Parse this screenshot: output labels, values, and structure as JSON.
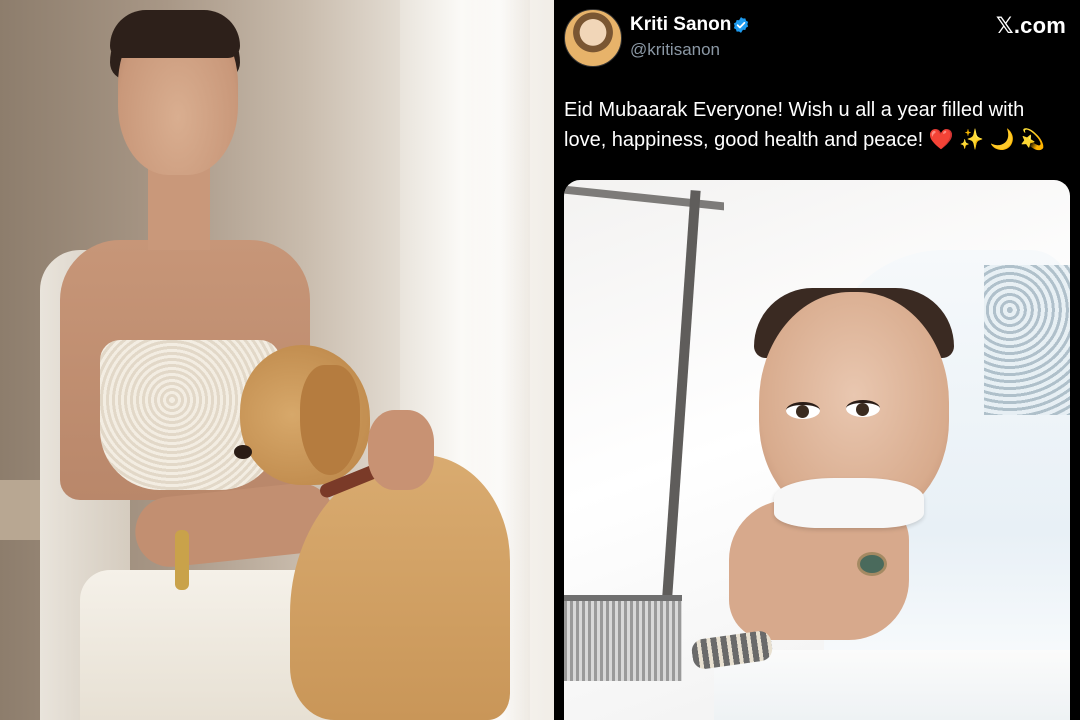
{
  "profile": {
    "display_name": "Kriti Sanon",
    "handle": "@kritisanon",
    "verified": true,
    "avatar_icon": "avatar-photo"
  },
  "brand": {
    "logo_text": "𝕏.com"
  },
  "tweet": {
    "text": "Eid Mubaarak Everyone! Wish u all a year filled with love, happiness, good health and peace!",
    "emojis": [
      "❤️",
      "✨",
      "🌙",
      "💫"
    ]
  },
  "colors": {
    "tweet_background": "#000000",
    "verified_badge": "#1d9bf0",
    "handle_text": "#8b98a5"
  },
  "icons": {
    "verified": "verified-badge-icon",
    "brand": "x-logo-icon"
  }
}
